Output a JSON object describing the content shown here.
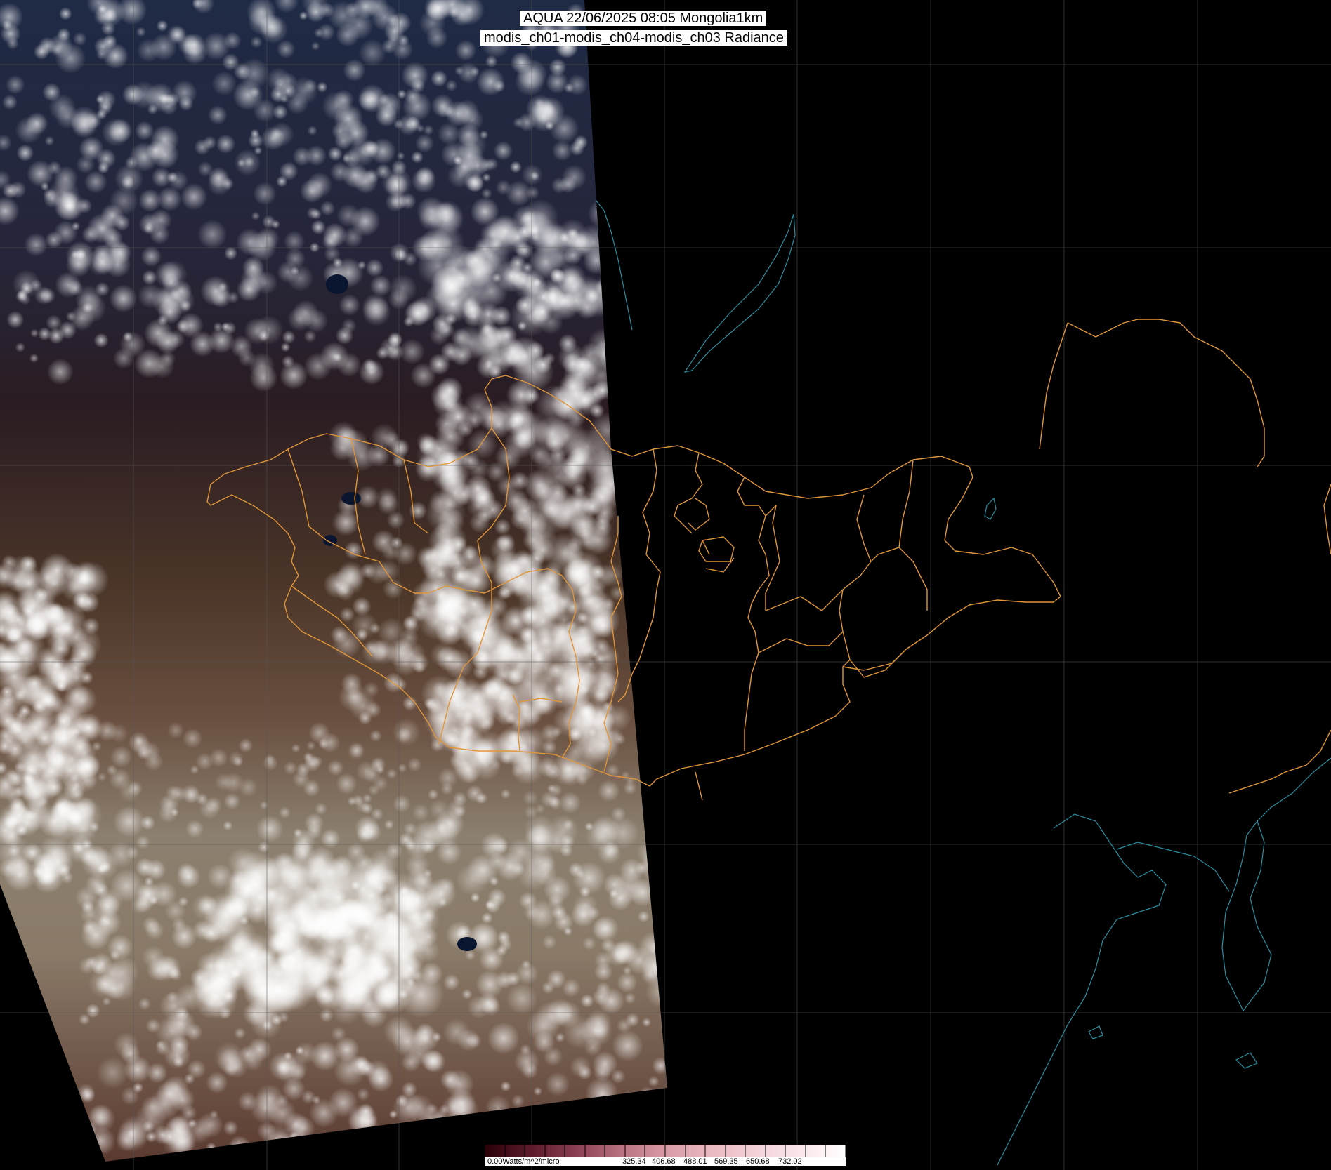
{
  "title": {
    "line1": "AQUA 22/06/2025 08:05 Mongolia1km",
    "line2": "modis_ch01-modis_ch04-modis_ch03 Radiance"
  },
  "colorbar": {
    "unit_label": "0.00Watts/m^2/micro",
    "tick_labels": [
      "325.34",
      "406.68",
      "488.01",
      "569.35",
      "650.68",
      "732.02"
    ],
    "colors": [
      "#2a0008",
      "#5a1a2a",
      "#8a3e52",
      "#b8707e",
      "#d89aa6",
      "#eab8c0",
      "#f3d2d8",
      "#fae6ea",
      "#ffffff"
    ]
  },
  "colors": {
    "grid": "#555555",
    "border": "#e0963a",
    "coast": "#2c8ea0"
  }
}
